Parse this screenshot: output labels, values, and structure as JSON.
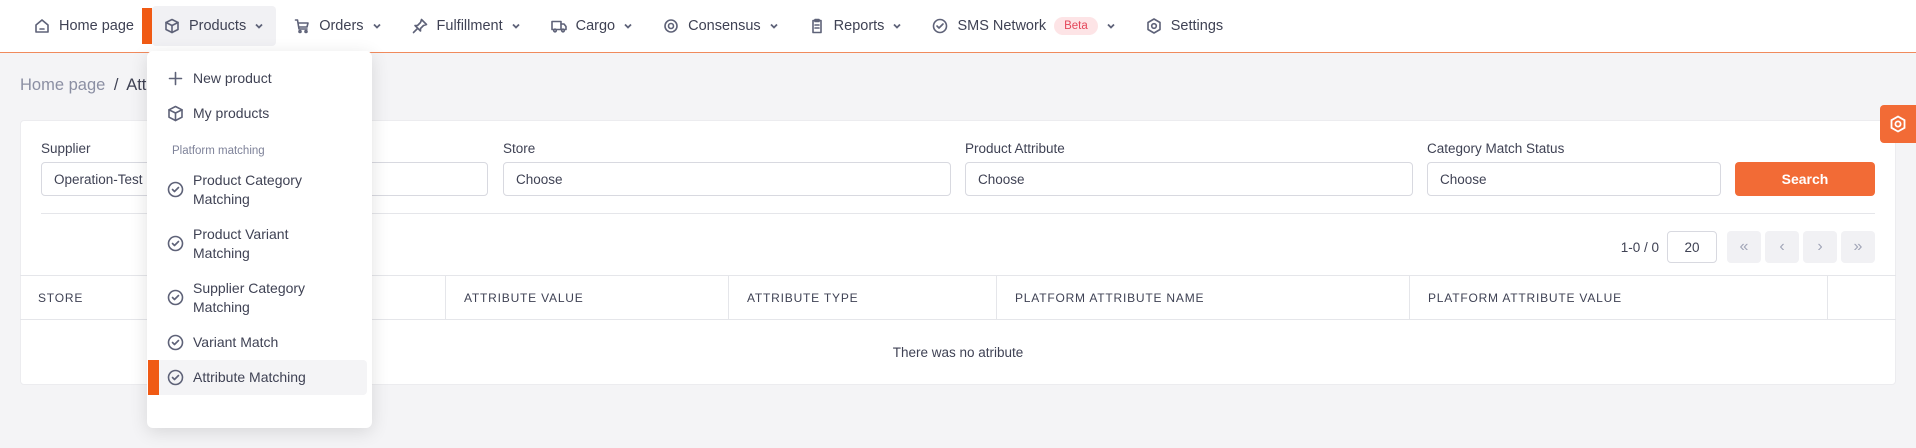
{
  "nav": {
    "items": [
      {
        "label": "Home page",
        "icon": "home-icon"
      },
      {
        "label": "Products",
        "icon": "box-icon"
      },
      {
        "label": "Orders",
        "icon": "cart-icon"
      },
      {
        "label": "Fulfillment",
        "icon": "pin-icon"
      },
      {
        "label": "Cargo",
        "icon": "truck-icon"
      },
      {
        "label": "Consensus",
        "icon": "target-icon"
      },
      {
        "label": "Reports",
        "icon": "clipboard-icon"
      },
      {
        "label": "SMS Network",
        "icon": "check-circle-icon",
        "badge": "Beta"
      },
      {
        "label": "Settings",
        "icon": "gear-icon"
      }
    ],
    "accent": "#f05a14"
  },
  "breadcrumb": {
    "home": "Home page",
    "separator": "/",
    "current": "Attr"
  },
  "filters": {
    "supplier": {
      "label": "Supplier",
      "value": "Operation-Test"
    },
    "store": {
      "label": "Store",
      "placeholder": "Choose"
    },
    "product_attribute": {
      "label": "Product Attribute",
      "placeholder": "Choose"
    },
    "category_match_status": {
      "label": "Category Match Status",
      "placeholder": "Choose"
    },
    "search_label": "Search"
  },
  "pager": {
    "info": "1-0 / 0",
    "page_size": "20",
    "first": "«",
    "prev": "‹",
    "next": "›",
    "last": "»"
  },
  "table": {
    "columns": [
      "STORE",
      "ATTRIBUTE VALUE",
      "ATTRIBUTE TYPE",
      "PLATFORM ATTRIBUTE NAME",
      "PLATFORM ATTRIBUTE VALUE"
    ],
    "empty_text": "There was no atribute"
  },
  "dropdown": {
    "new_product": "New product",
    "my_products": "My products",
    "section": "Platform matching",
    "items": [
      "Product Category Matching",
      "Product Variant Matching",
      "Supplier Category Matching",
      "Variant Match",
      "Attribute Matching"
    ],
    "product_category_1": "Product Category",
    "product_category_2": "Matching",
    "product_variant_1": "Product Variant",
    "product_variant_2": "Matching",
    "supplier_category_1": "Supplier Category",
    "supplier_category_2": "Matching",
    "variant_match": "Variant Match",
    "attribute_matching": "Attribute Matching"
  }
}
